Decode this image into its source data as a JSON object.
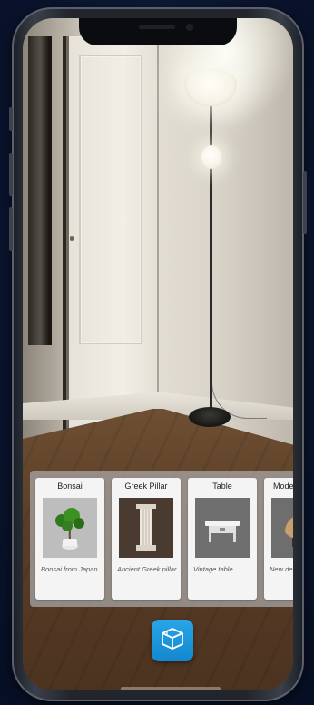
{
  "ar_gallery": {
    "items": [
      {
        "title": "Bonsai",
        "description": "Bonsai from Japan",
        "icon": "bonsai-tree-icon"
      },
      {
        "title": "Greek Pillar",
        "description": "Ancient Greek pillar",
        "icon": "greek-pillar-icon"
      },
      {
        "title": "Table",
        "description": "Vintage table",
        "icon": "vintage-table-icon"
      },
      {
        "title": "Moder",
        "description": "New des chair",
        "icon": "modern-chair-icon"
      }
    ]
  },
  "ar_button": {
    "icon": "ar-box-icon",
    "color": "#1e9ae0"
  }
}
